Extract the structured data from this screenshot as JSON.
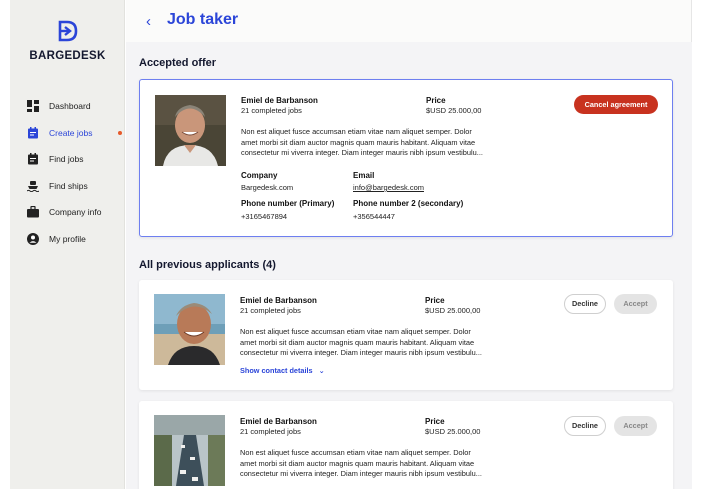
{
  "brand": {
    "name": "BARGEDESK",
    "accent": "#2b45d8",
    "danger": "#c8321f"
  },
  "nav": [
    {
      "label": "Dashboard",
      "icon": "dashboard-icon"
    },
    {
      "label": "Create jobs",
      "icon": "create-jobs-icon",
      "active": true,
      "notification_dot": true
    },
    {
      "label": "Find jobs",
      "icon": "find-jobs-icon"
    },
    {
      "label": "Find ships",
      "icon": "ship-icon"
    },
    {
      "label": "Company info",
      "icon": "briefcase-icon"
    },
    {
      "label": "My profile",
      "icon": "profile-icon"
    }
  ],
  "header": {
    "back_icon": "chevron-left-icon",
    "title": "Job taker"
  },
  "accepted": {
    "section_title": "Accepted offer",
    "name": "Emiel de Barbanson",
    "jobs": "21 completed jobs",
    "price_label": "Price",
    "price": "$USD 25.000,00",
    "desc1": "Non est aliquet fusce accumsan etiam vitae nam aliquet semper. Dolor",
    "desc2": "amet morbi sit diam auctor magnis quam mauris habitant. Aliquam vitae",
    "desc3": "consectetur mi viverra integer. Diam integer mauris nibh ipsum vestibulu...",
    "company_label": "Company",
    "company": "Bargedesk.com",
    "email_label": "Email",
    "email": "info@bargedesk.com",
    "phone1_label": "Phone number (Primary)",
    "phone1": "+3165467894",
    "phone2_label": "Phone number 2 (secondary)",
    "phone2": "+356544447",
    "cancel_label": "Cancel agreement"
  },
  "previous": {
    "section_title": "All previous applicants (4)",
    "items": [
      {
        "name": "Emiel de Barbanson",
        "jobs": "21 completed jobs",
        "price_label": "Price",
        "price": "$USD 25.000,00",
        "desc1": "Non est aliquet fusce accumsan etiam vitae nam aliquet semper. Dolor",
        "desc2": "amet morbi sit diam auctor magnis quam mauris habitant. Aliquam vitae",
        "desc3": "consectetur mi viverra integer. Diam integer mauris nibh ipsum vestibulu...",
        "show_contact": "Show contact details",
        "decline": "Decline",
        "accept": "Accept"
      },
      {
        "name": "Emiel de Barbanson",
        "jobs": "21 completed jobs",
        "price_label": "Price",
        "price": "$USD 25.000,00",
        "desc1": "Non est aliquet fusce accumsan etiam vitae nam aliquet semper. Dolor",
        "desc2": "amet morbi sit diam auctor magnis quam mauris habitant. Aliquam vitae",
        "desc3": "consectetur mi viverra integer. Diam integer mauris nibh ipsum vestibulu...",
        "decline": "Decline",
        "accept": "Accept"
      }
    ]
  }
}
